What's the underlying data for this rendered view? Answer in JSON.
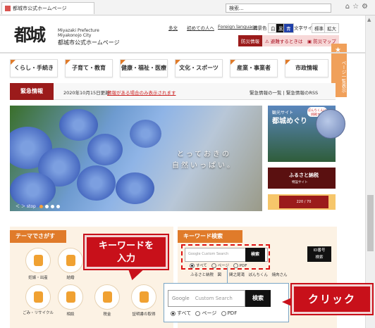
{
  "browser": {
    "tab_title": "都城市公式ホームページ",
    "address": "検索...",
    "icons": [
      "home-icon",
      "star-icon",
      "gear-icon"
    ]
  },
  "header": {
    "logo_text": "都城",
    "site_en1": "Miyazaki Prefecture",
    "site_en2": "Miyakonojo City",
    "site_jp": "都城市公式ホームページ",
    "util": {
      "multilingual": "多文",
      "first_time": "初めての人へ",
      "foreign": "Foreign language",
      "bgcolor": "背景色",
      "bg_white": "白",
      "bg_black": "黒",
      "bg_blue": "青",
      "fontsize": "文字サイズ",
      "standard": "標準",
      "enlarge": "拡大"
    },
    "disaster_button": "防災情報",
    "emergency_button": "避難するときは",
    "map_button": "防災マップ"
  },
  "nav": [
    "くらし・手続き",
    "子育て・教育",
    "健康・福祉・医療",
    "文化・スポーツ",
    "産業・事業者",
    "市政情報"
  ],
  "side_tab": {
    "label": "ページ一覧表示"
  },
  "emergency": {
    "label": "緊急情報",
    "date": "2020年10月15日更新",
    "message": "情報がある場合のみ表示されます",
    "list_link": "緊急情報の一覧",
    "rss_link": "緊急情報のRSS"
  },
  "hero": {
    "copy_line1": "とっておきの",
    "copy_line2": "自然いっぱい。",
    "stop_label": "stop"
  },
  "banners": {
    "tourism_small": "観光サイト",
    "tourism_title": "都城めぐり",
    "bubble": "ぼんちくんに挑戦する",
    "furusato_title": "ふるさと納税",
    "furusato_sub": "特設サイト",
    "bottom_banner": "220 / 70"
  },
  "theme": {
    "title": "テーマでさがす",
    "items": [
      "妊娠・出産",
      "結婚",
      "",
      "",
      "",
      "",
      "ごみ・リサイクル",
      "相談",
      "税金",
      "証明書の取得"
    ]
  },
  "keyword": {
    "title": "キーワード検索",
    "placeholder": "Google  Custom Search",
    "search_button": "検索",
    "id_button_line1": "ID番号",
    "id_button_line2": "検索",
    "radio_all": "すべて",
    "radio_page": "ページ",
    "radio_pdf": "PDF",
    "tags": "ふるさと納税　図　　関之尾滝　ぼんちくん　焼肉さん"
  },
  "zoom": {
    "google": "Google",
    "placeholder": "Custom Search",
    "search_button": "検索",
    "radio_all": "すべて",
    "radio_page": "ページ",
    "radio_pdf": "PDF"
  },
  "callouts": {
    "input_line1": "キーワードを",
    "input_line2": "入力",
    "click": "クリック"
  }
}
